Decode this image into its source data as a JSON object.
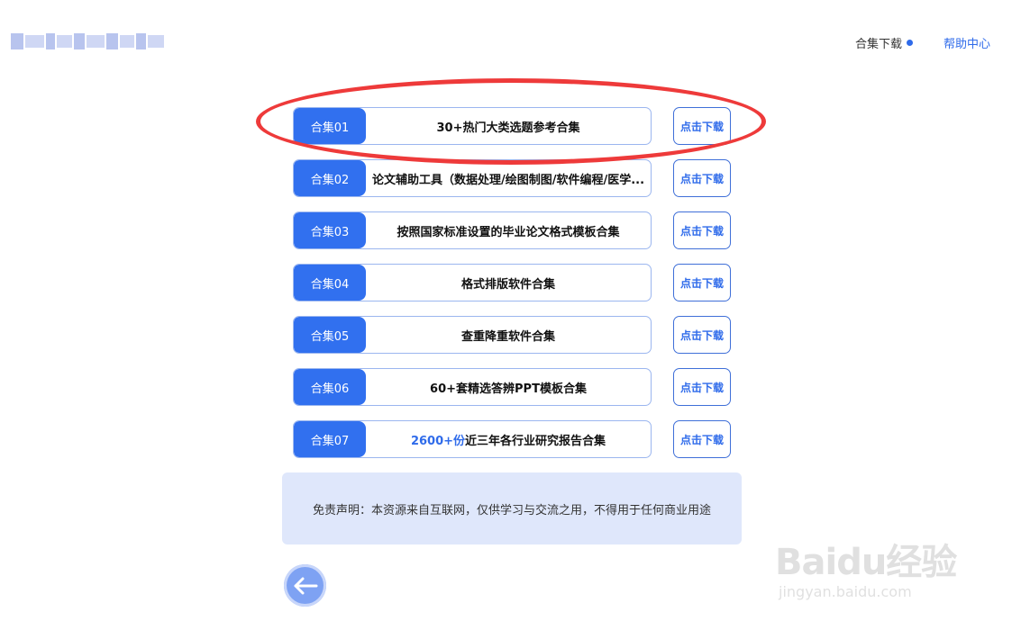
{
  "nav": {
    "collections_download": "合集下载",
    "help_center": "帮助中心"
  },
  "collections": [
    {
      "tag": "合集01",
      "title": "30+热门大类选题参考合集",
      "highlight": "",
      "button": "点击下载"
    },
    {
      "tag": "合集02",
      "title": "论文辅助工具（数据处理/绘图制图/软件编程/医学...",
      "highlight": "",
      "button": "点击下载"
    },
    {
      "tag": "合集03",
      "title": "按照国家标准设置的毕业论文格式模板合集",
      "highlight": "",
      "button": "点击下载"
    },
    {
      "tag": "合集04",
      "title": "格式排版软件合集",
      "highlight": "",
      "button": "点击下载"
    },
    {
      "tag": "合集05",
      "title": "查重降重软件合集",
      "highlight": "",
      "button": "点击下载"
    },
    {
      "tag": "合集06",
      "title": "60+套精选答辨PPT模板合集",
      "highlight": "",
      "button": "点击下载"
    },
    {
      "tag": "合集07",
      "title": "近三年各行业研究报告合集",
      "highlight": "2600+份",
      "button": "点击下载"
    }
  ],
  "disclaimer": "免责声明：本资源来自互联网，仅供学习与交流之用，不得用于任何商业用途",
  "watermark": {
    "brand": "Baidu经验",
    "url": "jingyan.baidu.com"
  },
  "colors": {
    "primary": "#3170ef",
    "annotation": "#ee3a3a",
    "disclaimer_bg": "#dfe7fb"
  },
  "icons": {
    "back": "arrow-left-icon",
    "nav_indicator": "dot-icon"
  }
}
